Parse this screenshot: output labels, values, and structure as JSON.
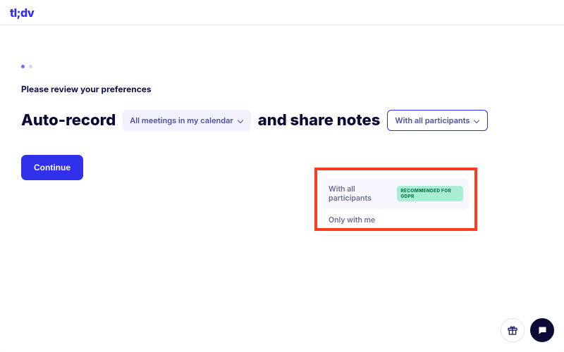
{
  "logo": "tl;dv",
  "subtitle": "Please review your preferences",
  "sentence": {
    "part1": "Auto-record",
    "part2": "and share notes"
  },
  "select_record": {
    "value": "All meetings in my calendar"
  },
  "select_share": {
    "value": "With all participants"
  },
  "share_options": {
    "opt0": {
      "label": "With all participants",
      "badge": "RECOMMENDED FOR GDPR"
    },
    "opt1": {
      "label": "Only with me"
    }
  },
  "cta": {
    "continue": "Continue"
  },
  "icons": {
    "gift": "gift-icon",
    "chat": "chat-icon"
  }
}
